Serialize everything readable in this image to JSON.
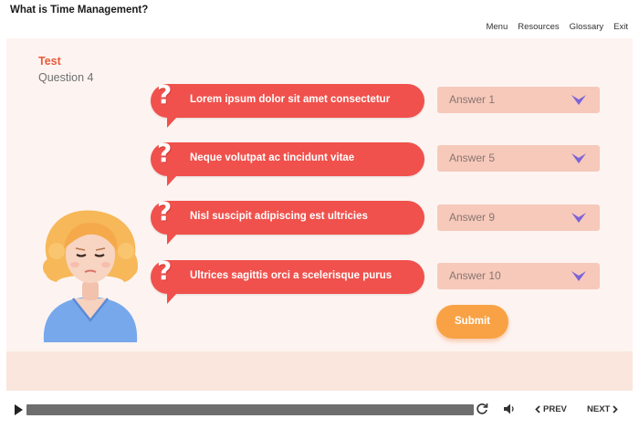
{
  "header": {
    "title": "What is Time Management?",
    "nav": [
      "Menu",
      "Resources",
      "Glossary",
      "Exit"
    ]
  },
  "quiz": {
    "label": "Test",
    "question": "Question 4",
    "items": [
      {
        "prompt": "Lorem ipsum dolor sit amet consectetur",
        "answer": "Answer 1"
      },
      {
        "prompt": "Neque volutpat ac tincidunt vitae",
        "answer": "Answer 5"
      },
      {
        "prompt": "Nisl suscipit adipiscing est ultricies",
        "answer": "Answer 9"
      },
      {
        "prompt": "Ultrices sagittis orci a scelerisque purus",
        "answer": "Answer 10"
      }
    ],
    "submit_label": "Submit"
  },
  "player": {
    "prev_label": "PREV",
    "next_label": "NEXT",
    "progress": 1.0
  },
  "icons": {
    "prompt": "question-mark-icon",
    "dropdown": "chevron-down-icon",
    "play": "play-icon",
    "replay": "replay-icon",
    "volume": "volume-icon",
    "prev": "chevron-left-icon",
    "next": "chevron-right-icon"
  },
  "colors": {
    "accent_red": "#f0514c",
    "dropdown_bg": "#f6c9ba",
    "chevron": "#7b63d8",
    "submit": "#f8a245",
    "test_label": "#e85c3b"
  }
}
